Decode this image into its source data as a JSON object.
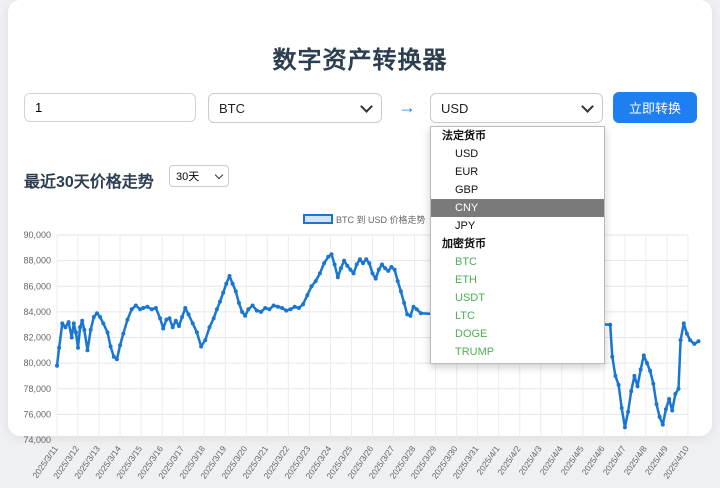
{
  "title": "数字资产转换器",
  "amount": "1",
  "from_currency": "BTC",
  "to_currency": "USD",
  "arrow": "→",
  "convert_button": "立即转换",
  "trend_title": "最近30天价格走势",
  "range_value": "30天",
  "dropdown": {
    "fiat_label": "法定货币",
    "fiat": [
      "USD",
      "EUR",
      "GBP",
      "CNY",
      "JPY"
    ],
    "crypto_label": "加密货币",
    "crypto": [
      "BTC",
      "ETH",
      "USDT",
      "LTC",
      "DOGE",
      "TRUMP"
    ],
    "highlighted": "CNY"
  },
  "colors": {
    "accent": "#1e7ff0",
    "line": "#1976d2",
    "crypto_text": "#4caf50",
    "title": "#2c3e50"
  },
  "chart_data": {
    "type": "line",
    "legend": "BTC 到 USD 价格走势",
    "legend_position": "top-center",
    "grid": true,
    "ylim": [
      74000,
      90000
    ],
    "yticks": [
      "90,000",
      "88,000",
      "86,000",
      "84,000",
      "82,000",
      "80,000",
      "78,000",
      "76,000",
      "74,000"
    ],
    "categories": [
      "2025/3/11",
      "2025/3/12",
      "2025/3/13",
      "2025/3/14",
      "2025/3/15",
      "2025/3/16",
      "2025/3/17",
      "2025/3/18",
      "2025/3/19",
      "2025/3/20",
      "2025/3/21",
      "2025/3/22",
      "2025/3/23",
      "2025/3/24",
      "2025/3/25",
      "2025/3/26",
      "2025/3/27",
      "2025/3/28",
      "2025/3/29",
      "2025/3/30",
      "2025/3/31",
      "2025/4/1",
      "2025/4/2",
      "2025/4/3",
      "2025/4/4",
      "2025/4/5",
      "2025/4/6",
      "2025/4/7",
      "2025/4/8",
      "2025/4/9",
      "2025/4/10"
    ],
    "series": [
      {
        "name": "BTC 到 USD 价格走势",
        "points": [
          [
            0,
            79800
          ],
          [
            0.1,
            81200
          ],
          [
            0.25,
            83100
          ],
          [
            0.4,
            82800
          ],
          [
            0.55,
            83200
          ],
          [
            0.7,
            82000
          ],
          [
            0.8,
            83100
          ],
          [
            0.9,
            82400
          ],
          [
            1.0,
            81200
          ],
          [
            1.1,
            82800
          ],
          [
            1.2,
            83300
          ],
          [
            1.3,
            82600
          ],
          [
            1.45,
            81000
          ],
          [
            1.6,
            82600
          ],
          [
            1.75,
            83600
          ],
          [
            1.9,
            83900
          ],
          [
            2.05,
            83600
          ],
          [
            2.2,
            83100
          ],
          [
            2.4,
            82400
          ],
          [
            2.55,
            81300
          ],
          [
            2.7,
            80500
          ],
          [
            2.85,
            80300
          ],
          [
            3.0,
            81400
          ],
          [
            3.15,
            82300
          ],
          [
            3.35,
            83400
          ],
          [
            3.55,
            84200
          ],
          [
            3.75,
            84500
          ],
          [
            3.95,
            84200
          ],
          [
            4.1,
            84300
          ],
          [
            4.3,
            84400
          ],
          [
            4.5,
            84200
          ],
          [
            4.7,
            84300
          ],
          [
            4.9,
            83500
          ],
          [
            5.05,
            82700
          ],
          [
            5.2,
            83400
          ],
          [
            5.35,
            83500
          ],
          [
            5.5,
            82800
          ],
          [
            5.65,
            83300
          ],
          [
            5.8,
            82900
          ],
          [
            5.95,
            83600
          ],
          [
            6.1,
            84300
          ],
          [
            6.25,
            83800
          ],
          [
            6.45,
            83100
          ],
          [
            6.65,
            82400
          ],
          [
            6.85,
            81300
          ],
          [
            7.05,
            81800
          ],
          [
            7.25,
            82800
          ],
          [
            7.45,
            83500
          ],
          [
            7.6,
            84200
          ],
          [
            7.75,
            84800
          ],
          [
            7.9,
            85500
          ],
          [
            8.05,
            86200
          ],
          [
            8.2,
            86800
          ],
          [
            8.35,
            86200
          ],
          [
            8.5,
            85600
          ],
          [
            8.65,
            84700
          ],
          [
            8.8,
            84000
          ],
          [
            8.95,
            83700
          ],
          [
            9.1,
            84200
          ],
          [
            9.3,
            84500
          ],
          [
            9.5,
            84100
          ],
          [
            9.7,
            84000
          ],
          [
            9.9,
            84300
          ],
          [
            10.1,
            84200
          ],
          [
            10.3,
            84500
          ],
          [
            10.5,
            84400
          ],
          [
            10.7,
            84300
          ],
          [
            10.9,
            84100
          ],
          [
            11.1,
            84200
          ],
          [
            11.3,
            84400
          ],
          [
            11.5,
            84300
          ],
          [
            11.7,
            84600
          ],
          [
            11.9,
            85300
          ],
          [
            12.1,
            86000
          ],
          [
            12.3,
            86400
          ],
          [
            12.5,
            87000
          ],
          [
            12.7,
            87800
          ],
          [
            12.9,
            88300
          ],
          [
            13.05,
            88500
          ],
          [
            13.2,
            87700
          ],
          [
            13.35,
            86700
          ],
          [
            13.5,
            87400
          ],
          [
            13.65,
            88000
          ],
          [
            13.8,
            87600
          ],
          [
            13.95,
            87300
          ],
          [
            14.1,
            87000
          ],
          [
            14.25,
            87700
          ],
          [
            14.4,
            88100
          ],
          [
            14.55,
            87800
          ],
          [
            14.7,
            88100
          ],
          [
            14.85,
            87800
          ],
          [
            15.0,
            87000
          ],
          [
            15.15,
            86600
          ],
          [
            15.3,
            87300
          ],
          [
            15.45,
            87700
          ],
          [
            15.6,
            87400
          ],
          [
            15.75,
            87200
          ],
          [
            15.9,
            87500
          ],
          [
            16.05,
            87300
          ],
          [
            16.2,
            86400
          ],
          [
            16.35,
            85600
          ],
          [
            16.5,
            84700
          ],
          [
            16.65,
            83800
          ],
          [
            16.8,
            83700
          ],
          [
            16.95,
            84400
          ],
          [
            17.1,
            84200
          ],
          [
            17.3,
            83900
          ],
          [
            26.3,
            83000
          ],
          [
            26.4,
            80500
          ],
          [
            26.55,
            79000
          ],
          [
            26.7,
            78300
          ],
          [
            26.85,
            76500
          ],
          [
            27.0,
            75000
          ],
          [
            27.15,
            76200
          ],
          [
            27.3,
            77800
          ],
          [
            27.45,
            79000
          ],
          [
            27.6,
            78200
          ],
          [
            27.75,
            79500
          ],
          [
            27.9,
            80600
          ],
          [
            28.05,
            80000
          ],
          [
            28.2,
            79400
          ],
          [
            28.35,
            78400
          ],
          [
            28.5,
            76800
          ],
          [
            28.65,
            75800
          ],
          [
            28.8,
            75200
          ],
          [
            28.95,
            76400
          ],
          [
            29.1,
            77200
          ],
          [
            29.25,
            76300
          ],
          [
            29.4,
            77600
          ],
          [
            29.55,
            78000
          ],
          [
            29.65,
            81800
          ],
          [
            29.8,
            83100
          ],
          [
            29.95,
            82300
          ],
          [
            30.1,
            81800
          ],
          [
            30.3,
            81500
          ],
          [
            30.5,
            81700
          ]
        ]
      }
    ]
  }
}
